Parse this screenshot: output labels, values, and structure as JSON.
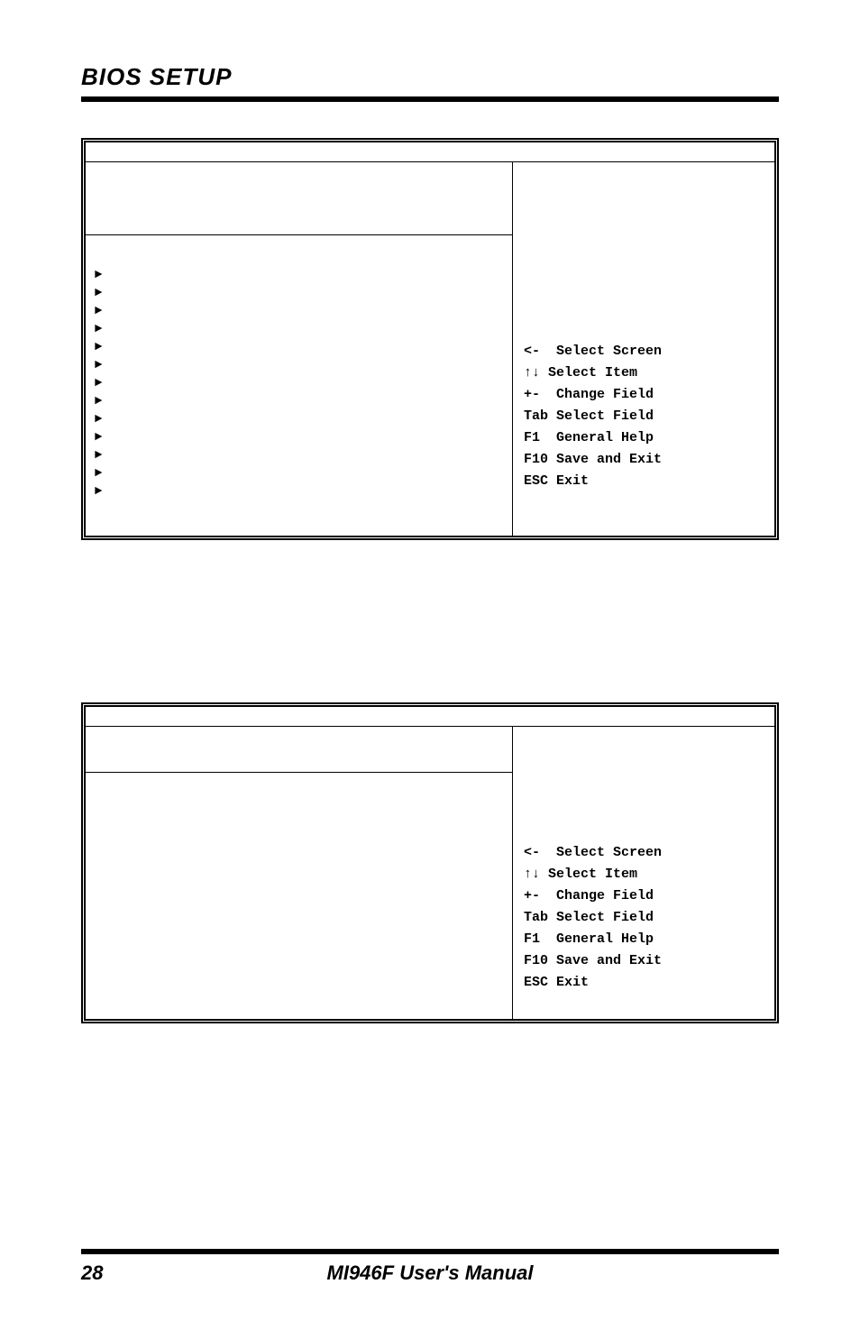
{
  "header": {
    "title": "BIOS SETUP"
  },
  "box1": {
    "arrows": [
      "►",
      "►",
      "►",
      "►",
      "►",
      "►",
      "►",
      "►",
      "►",
      "►",
      "►",
      "►",
      "►"
    ],
    "help": {
      "l1": "<-  Select Screen",
      "l2": "↑↓ Select Item",
      "l3": "+-  Change Field",
      "l4": "Tab Select Field",
      "l5": "F1  General Help",
      "l6": "F10 Save and Exit",
      "l7": "ESC Exit"
    }
  },
  "box2": {
    "help": {
      "l1": "<-  Select Screen",
      "l2": "↑↓ Select Item",
      "l3": "+-  Change Field",
      "l4": "Tab Select Field",
      "l5": "F1  General Help",
      "l6": "F10 Save and Exit",
      "l7": "ESC Exit"
    }
  },
  "footer": {
    "page": "28",
    "title": "MI946F User's Manual"
  }
}
